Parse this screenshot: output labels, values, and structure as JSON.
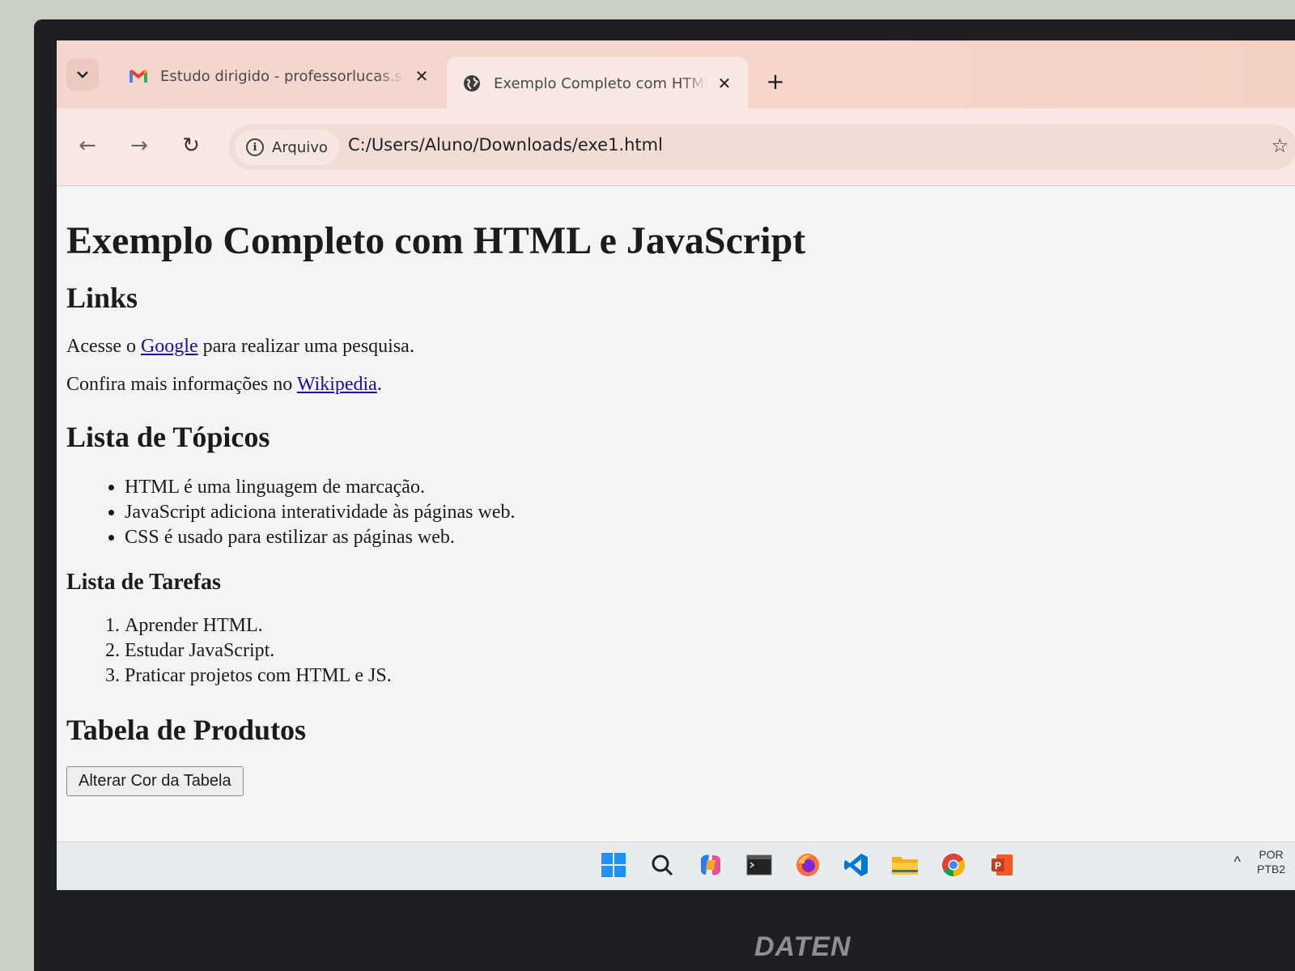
{
  "browser": {
    "tabs": [
      {
        "title": "Estudo dirigido - professorlucas.sc",
        "favicon": "gmail-icon",
        "active": false
      },
      {
        "title": "Exemplo Completo com HTML e Ja",
        "favicon": "globe-icon",
        "active": true
      }
    ],
    "new_tab_label": "+",
    "address": {
      "chip_label": "Arquivo",
      "url": "C:/Users/Aluno/Downloads/exe1.html"
    }
  },
  "page": {
    "title": "Exemplo Completo com HTML e JavaScript",
    "links_heading": "Links",
    "p1_before": "Acesse o ",
    "p1_link": "Google",
    "p1_after": " para realizar uma pesquisa.",
    "p2_before": "Confira mais informações no ",
    "p2_link": "Wikipedia",
    "p2_after": ".",
    "topics_heading": "Lista de Tópicos",
    "topics": [
      "HTML é uma linguagem de marcação.",
      "JavaScript adiciona interatividade às páginas web.",
      "CSS é usado para estilizar as páginas web."
    ],
    "tasks_heading": "Lista de Tarefas",
    "tasks": [
      "Aprender HTML.",
      "Estudar JavaScript.",
      "Praticar projetos com HTML e JS."
    ],
    "products_heading": "Tabela de Produtos",
    "change_color_button": "Alterar Cor da Tabela"
  },
  "taskbar": {
    "apps": [
      "windows-start-icon",
      "search-icon",
      "copilot-icon",
      "terminal-icon",
      "firefox-icon",
      "vscode-icon",
      "file-explorer-icon",
      "chrome-icon",
      "powerpoint-icon"
    ],
    "language_line1": "POR",
    "language_line2": "PTB2"
  },
  "monitor_brand": "DATEN"
}
